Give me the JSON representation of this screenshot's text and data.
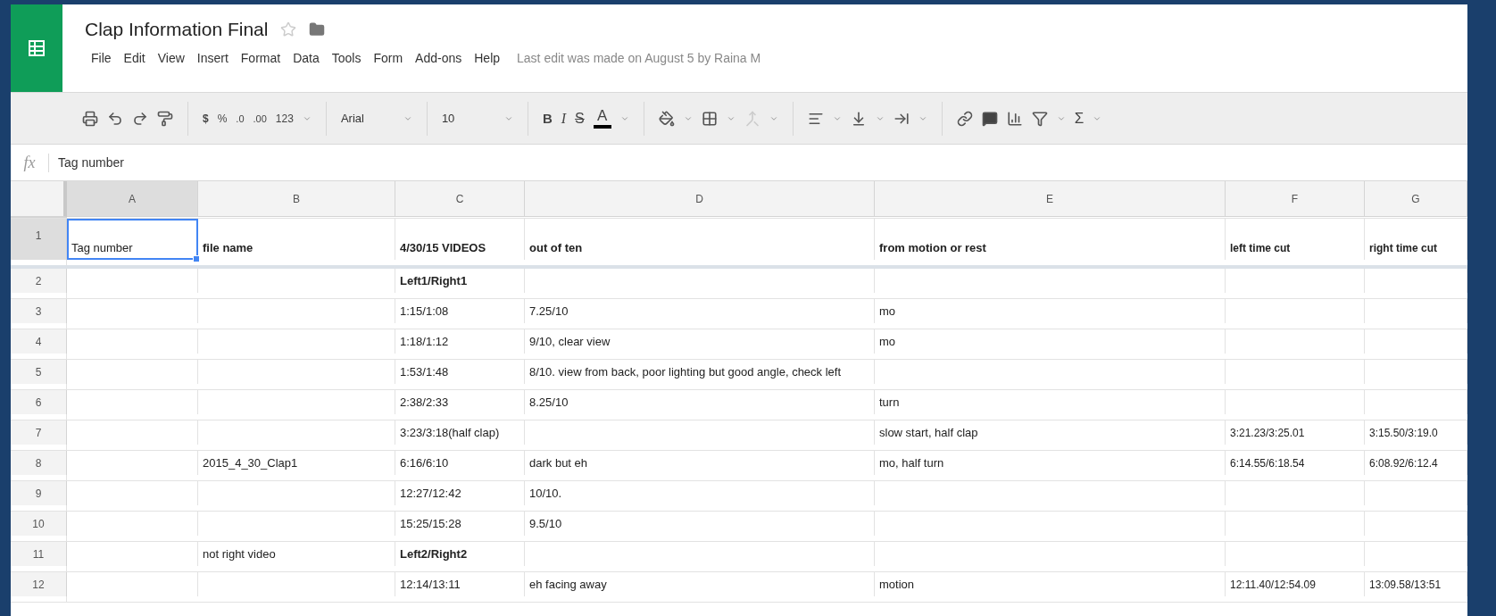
{
  "document": {
    "title": "Clap Information Final",
    "starred": false
  },
  "menu": [
    "File",
    "Edit",
    "View",
    "Insert",
    "Format",
    "Data",
    "Tools",
    "Form",
    "Add-ons",
    "Help"
  ],
  "last_edit": "Last edit was made on August 5 by Raina M",
  "toolbar": {
    "currency": "$",
    "percent": "%",
    "decrease_decimals": ".0",
    "increase_decimals": ".00",
    "number_format": "123",
    "font": "Arial",
    "font_size": "10",
    "bold": "B",
    "italic": "I",
    "strikethrough": "S",
    "text_color": "A",
    "functions": "Σ"
  },
  "formula_bar": {
    "label": "fx",
    "value": "Tag number"
  },
  "columns": [
    {
      "label": "A",
      "selected": true
    },
    {
      "label": "B",
      "selected": false
    },
    {
      "label": "C",
      "selected": false
    },
    {
      "label": "D",
      "selected": false
    },
    {
      "label": "E",
      "selected": false
    },
    {
      "label": "F",
      "selected": false
    },
    {
      "label": "G",
      "selected": false
    }
  ],
  "rows": [
    {
      "number": "1",
      "selected": true,
      "cells": [
        {
          "text": "Tag number",
          "bold": false,
          "selected": true
        },
        {
          "text": "file name",
          "bold": true,
          "selected": false
        },
        {
          "text": "4/30/15 VIDEOS",
          "bold": true,
          "selected": false
        },
        {
          "text": "out of ten",
          "bold": true,
          "selected": false
        },
        {
          "text": "from motion or rest",
          "bold": true,
          "selected": false
        },
        {
          "text": "left time cut",
          "bold": true,
          "selected": false
        },
        {
          "text": "right time cut",
          "bold": true,
          "selected": false
        }
      ]
    },
    {
      "number": "2",
      "selected": false,
      "cells": [
        {},
        {},
        {
          "text": "Left1/Right1",
          "bold": true,
          "selected": false
        },
        {},
        {},
        {},
        {}
      ]
    },
    {
      "number": "3",
      "selected": false,
      "cells": [
        {},
        {},
        {
          "text": "1:15/1:08",
          "bold": false,
          "selected": false
        },
        {
          "text": "7.25/10",
          "bold": false,
          "selected": false
        },
        {
          "text": "mo",
          "bold": false,
          "selected": false
        },
        {},
        {}
      ]
    },
    {
      "number": "4",
      "selected": false,
      "cells": [
        {},
        {},
        {
          "text": "1:18/1:12",
          "bold": false,
          "selected": false
        },
        {
          "text": "9/10, clear view",
          "bold": false,
          "selected": false
        },
        {
          "text": "mo",
          "bold": false,
          "selected": false
        },
        {},
        {}
      ]
    },
    {
      "number": "5",
      "selected": false,
      "cells": [
        {},
        {},
        {
          "text": "1:53/1:48",
          "bold": false,
          "selected": false
        },
        {
          "text": "8/10. view from back, poor lighting but good angle, check left",
          "bold": false,
          "selected": false
        },
        {},
        {},
        {}
      ]
    },
    {
      "number": "6",
      "selected": false,
      "cells": [
        {},
        {},
        {
          "text": "2:38/2:33",
          "bold": false,
          "selected": false
        },
        {
          "text": "8.25/10",
          "bold": false,
          "selected": false
        },
        {
          "text": "turn",
          "bold": false,
          "selected": false
        },
        {},
        {}
      ]
    },
    {
      "number": "7",
      "selected": false,
      "cells": [
        {},
        {},
        {
          "text": "3:23/3:18(half clap)",
          "bold": false,
          "selected": false
        },
        {},
        {
          "text": "slow start, half clap",
          "bold": false,
          "selected": false
        },
        {
          "text": "3:21.23/3:25.01",
          "bold": false,
          "selected": false
        },
        {
          "text": "3:15.50/3:19.0",
          "bold": false,
          "selected": false
        }
      ]
    },
    {
      "number": "8",
      "selected": false,
      "cells": [
        {},
        {
          "text": "2015_4_30_Clap1",
          "bold": false,
          "selected": false
        },
        {
          "text": "6:16/6:10",
          "bold": false,
          "selected": false
        },
        {
          "text": "dark but eh",
          "bold": false,
          "selected": false
        },
        {
          "text": "mo, half turn",
          "bold": false,
          "selected": false
        },
        {
          "text": "6:14.55/6:18.54",
          "bold": false,
          "selected": false
        },
        {
          "text": "6:08.92/6:12.4",
          "bold": false,
          "selected": false
        }
      ]
    },
    {
      "number": "9",
      "selected": false,
      "cells": [
        {},
        {},
        {
          "text": "12:27/12:42",
          "bold": false,
          "selected": false
        },
        {
          "text": "10/10.",
          "bold": false,
          "selected": false
        },
        {},
        {},
        {}
      ]
    },
    {
      "number": "10",
      "selected": false,
      "cells": [
        {},
        {},
        {
          "text": "15:25/15:28",
          "bold": false,
          "selected": false
        },
        {
          "text": "9.5/10",
          "bold": false,
          "selected": false
        },
        {},
        {},
        {}
      ]
    },
    {
      "number": "11",
      "selected": false,
      "cells": [
        {},
        {
          "text": "not right video",
          "bold": false,
          "selected": false
        },
        {
          "text": "Left2/Right2",
          "bold": true,
          "selected": false
        },
        {},
        {},
        {},
        {}
      ]
    },
    {
      "number": "12",
      "selected": false,
      "cells": [
        {},
        {},
        {
          "text": "12:14/13:11",
          "bold": false,
          "selected": false
        },
        {
          "text": "eh facing away",
          "bold": false,
          "selected": false
        },
        {
          "text": "motion",
          "bold": false,
          "selected": false
        },
        {
          "text": "12:11.40/12:54.09",
          "bold": false,
          "selected": false
        },
        {
          "text": "13:09.58/13:51",
          "bold": false,
          "selected": false
        }
      ]
    }
  ]
}
